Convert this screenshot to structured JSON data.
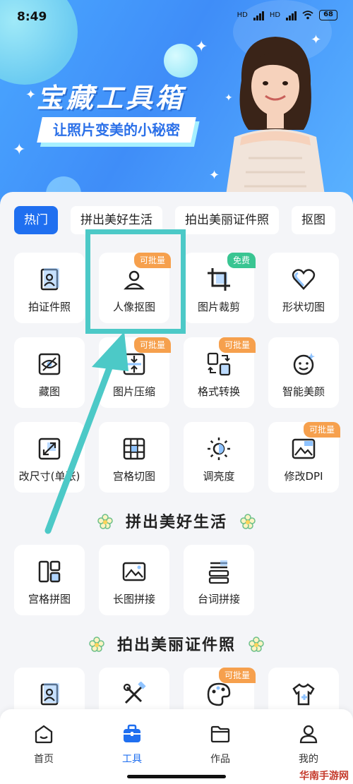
{
  "status": {
    "time": "8:49",
    "net1": "HD",
    "net2": "HD",
    "battery": "68"
  },
  "banner": {
    "title": "宝藏工具箱",
    "subtitle": "让照片变美的小秘密"
  },
  "tabs": [
    {
      "label": "热门",
      "active": true
    },
    {
      "label": "拼出美好生活",
      "active": false
    },
    {
      "label": "拍出美丽证件照",
      "active": false
    },
    {
      "label": "抠图",
      "active": false
    }
  ],
  "hot_tools": [
    {
      "label": "拍证件照",
      "icon": "id-photo-icon",
      "badge": ""
    },
    {
      "label": "人像抠图",
      "icon": "portrait-cutout-icon",
      "badge": "可批量"
    },
    {
      "label": "图片裁剪",
      "icon": "crop-icon",
      "badge": "免费"
    },
    {
      "label": "形状切图",
      "icon": "heart-shape-icon",
      "badge": ""
    },
    {
      "label": "藏图",
      "icon": "hide-image-icon",
      "badge": ""
    },
    {
      "label": "图片压缩",
      "icon": "compress-icon",
      "badge": "可批量"
    },
    {
      "label": "格式转换",
      "icon": "format-convert-icon",
      "badge": "可批量"
    },
    {
      "label": "智能美颜",
      "icon": "smart-beauty-icon",
      "badge": ""
    },
    {
      "label": "改尺寸(单张)",
      "icon": "resize-icon",
      "badge": ""
    },
    {
      "label": "宫格切图",
      "icon": "grid-cut-icon",
      "badge": ""
    },
    {
      "label": "调亮度",
      "icon": "brightness-icon",
      "badge": ""
    },
    {
      "label": "修改DPI",
      "icon": "dpi-icon",
      "badge": "可批量"
    }
  ],
  "section2": {
    "title": "拼出美好生活"
  },
  "collage_tools": [
    {
      "label": "宫格拼图",
      "icon": "grid-collage-icon"
    },
    {
      "label": "长图拼接",
      "icon": "long-image-icon"
    },
    {
      "label": "台词拼接",
      "icon": "subtitle-stitch-icon"
    }
  ],
  "section3": {
    "title": "拍出美丽证件照"
  },
  "id_tools": [
    {
      "icon": "id-card-icon",
      "badge": ""
    },
    {
      "icon": "tools-icon",
      "badge": ""
    },
    {
      "icon": "palette-icon",
      "badge": "可批量"
    },
    {
      "icon": "outfit-icon",
      "badge": ""
    }
  ],
  "nav": [
    {
      "label": "首页",
      "icon": "home-icon",
      "active": false
    },
    {
      "label": "工具",
      "icon": "toolbox-icon",
      "active": true
    },
    {
      "label": "作品",
      "icon": "folder-icon",
      "active": false
    },
    {
      "label": "我的",
      "icon": "profile-icon",
      "active": false
    }
  ],
  "watermark": "华南手游网",
  "colors": {
    "accent": "#1f6ff0",
    "badge_orange": "#f6a04d",
    "badge_green": "#39c592",
    "highlight": "#4cc9c7"
  }
}
